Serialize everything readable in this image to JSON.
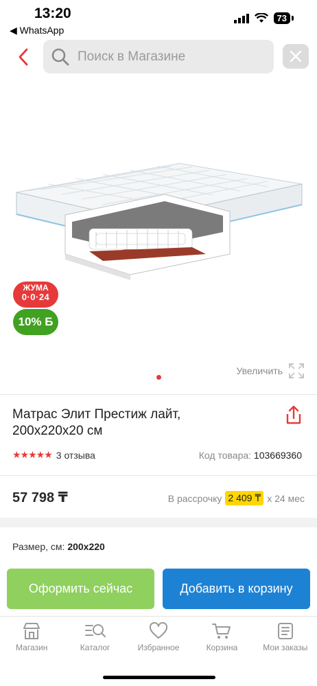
{
  "status_bar": {
    "time": "13:20",
    "back_app": "◀ WhatsApp",
    "battery": "73"
  },
  "search": {
    "placeholder": "Поиск в Магазине"
  },
  "gallery": {
    "badge_sale_line1": "ЖУМА",
    "badge_sale_line2": "0·0·24",
    "badge_bonus": "10% Б",
    "zoom_label": "Увеличить"
  },
  "product": {
    "title": "Матрас Элит Престиж лайт, 200x220x20 см",
    "rating_stars": 5,
    "reviews": "3 отзыва",
    "sku_label": "Код товара:",
    "sku_value": "103669360",
    "price": "57 798 ₸",
    "installment_label": "В рассрочку",
    "installment_amount": "2 409 ₸",
    "installment_term": "x 24 мес",
    "size_label": "Размер, см:",
    "size_value": "200x220"
  },
  "actions": {
    "order_now": "Оформить сейчас",
    "add_to_cart": "Добавить в корзину"
  },
  "tabbar": {
    "items": [
      {
        "label": "Магазин",
        "icon": "shop-icon"
      },
      {
        "label": "Каталог",
        "icon": "catalog-search-icon"
      },
      {
        "label": "Избранное",
        "icon": "heart-icon"
      },
      {
        "label": "Корзина",
        "icon": "cart-icon"
      },
      {
        "label": "Мои заказы",
        "icon": "orders-icon"
      }
    ]
  },
  "colors": {
    "accent_red": "#e63a3a",
    "order_green": "#8fd05e",
    "cart_blue": "#1e82d4",
    "installment_yellow": "#ffd600",
    "bonus_green": "#41a120"
  }
}
